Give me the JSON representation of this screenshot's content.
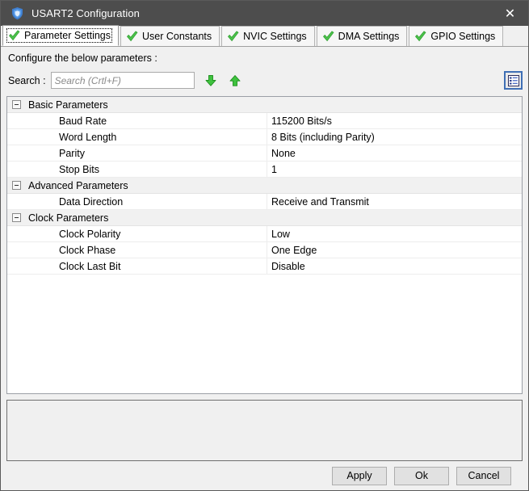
{
  "window": {
    "title": "USART2 Configuration",
    "icon": "shield-icon",
    "close_label": "✕",
    "titlebar_color": "#4d4d4d"
  },
  "tabs": [
    {
      "label": "Parameter Settings",
      "icon": "green-check-icon",
      "active": true
    },
    {
      "label": "User Constants",
      "icon": "green-check-icon",
      "active": false
    },
    {
      "label": "NVIC Settings",
      "icon": "green-check-icon",
      "active": false
    },
    {
      "label": "DMA Settings",
      "icon": "green-check-icon",
      "active": false
    },
    {
      "label": "GPIO Settings",
      "icon": "green-check-icon",
      "active": false
    }
  ],
  "main": {
    "hint": "Configure the below parameters :",
    "search": {
      "label": "Search :",
      "value": "",
      "placeholder": "Search (Crtl+F)",
      "find_next_icon": "green-down-arrow-icon",
      "find_prev_icon": "green-up-arrow-icon"
    },
    "listview_toggle_icon": "list-view-icon",
    "accent_green": "#3cc03c",
    "accent_blue": "#3f6fb5"
  },
  "parameters": [
    {
      "group": "Basic Parameters",
      "collapsed": false,
      "rows": [
        {
          "name": "Baud Rate",
          "value": "115200 Bits/s"
        },
        {
          "name": "Word Length",
          "value": "8 Bits (including Parity)"
        },
        {
          "name": "Parity",
          "value": "None"
        },
        {
          "name": "Stop Bits",
          "value": "1"
        }
      ]
    },
    {
      "group": "Advanced Parameters",
      "collapsed": false,
      "rows": [
        {
          "name": "Data Direction",
          "value": "Receive and Transmit"
        }
      ]
    },
    {
      "group": "Clock Parameters",
      "collapsed": false,
      "rows": [
        {
          "name": "Clock Polarity",
          "value": "Low"
        },
        {
          "name": "Clock Phase",
          "value": "One Edge"
        },
        {
          "name": "Clock Last Bit",
          "value": "Disable"
        }
      ]
    }
  ],
  "description_panel": {
    "text": ""
  },
  "footer": {
    "apply_label": "Apply",
    "ok_label": "Ok",
    "cancel_label": "Cancel"
  }
}
